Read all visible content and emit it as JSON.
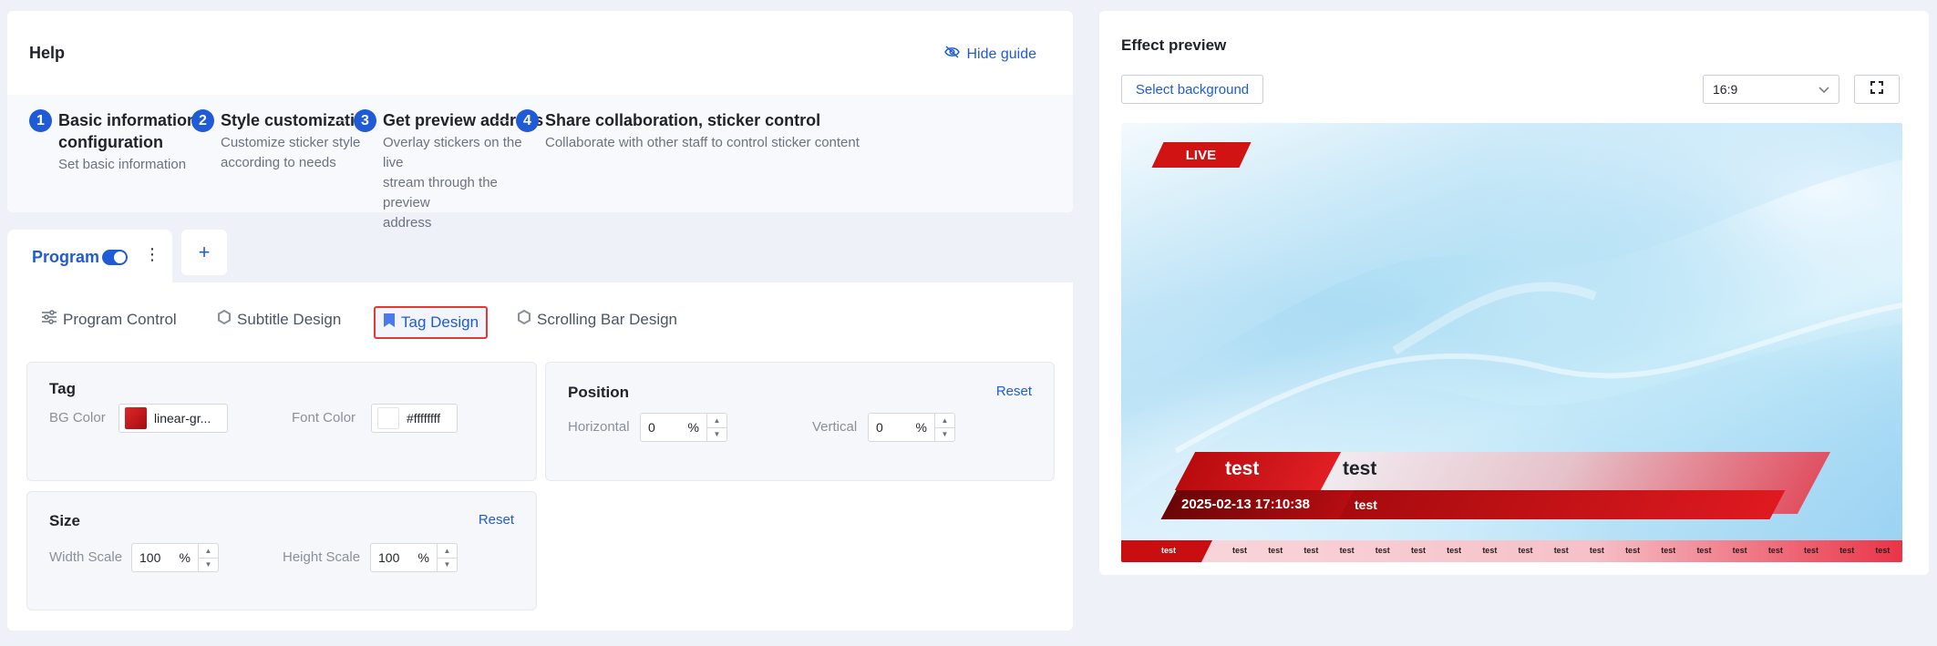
{
  "help": {
    "title": "Help",
    "hide_guide": "Hide guide",
    "steps": [
      {
        "num": "1",
        "title_line1": "Basic information",
        "title_line2": "configuration",
        "desc_lines": [
          "Set basic information"
        ]
      },
      {
        "num": "2",
        "title_line1": "Style customization",
        "desc_lines": [
          "Customize sticker style",
          "according to needs"
        ]
      },
      {
        "num": "3",
        "title_line1": "Get preview address",
        "desc_lines": [
          "Overlay stickers on the live",
          "stream through the preview",
          "address"
        ]
      },
      {
        "num": "4",
        "title_line1": "Share collaboration, sticker control",
        "desc_lines": [
          "Collaborate with other staff to control sticker content"
        ]
      }
    ]
  },
  "program_tab": {
    "label": "Program",
    "add_label": "+",
    "enabled": true
  },
  "sub_tabs": [
    {
      "label": "Program Control",
      "icon": "sliders-icon"
    },
    {
      "label": "Subtitle Design",
      "icon": "hexagon-icon"
    },
    {
      "label": "Tag Design",
      "icon": "bookmark-icon",
      "active": true
    },
    {
      "label": "Scrolling Bar Design",
      "icon": "hexagon-icon"
    }
  ],
  "tag_panel": {
    "title": "Tag",
    "bg_color_label": "BG Color",
    "bg_color_value": "linear-gr...",
    "font_color_label": "Font Color",
    "font_color_value": "#ffffffff"
  },
  "position_panel": {
    "title": "Position",
    "reset": "Reset",
    "horizontal_label": "Horizontal",
    "horizontal_value": "0",
    "vertical_label": "Vertical",
    "vertical_value": "0",
    "unit": "%"
  },
  "size_panel": {
    "title": "Size",
    "reset": "Reset",
    "width_label": "Width Scale",
    "width_value": "100",
    "height_label": "Height Scale",
    "height_value": "100",
    "unit": "%"
  },
  "preview": {
    "title": "Effect preview",
    "select_background": "Select background",
    "ratio": "16:9",
    "live_label": "LIVE",
    "lower_third": {
      "tag_text": "test",
      "title_text": "test",
      "datetime": "2025-02-13 17:10:38",
      "subtitle_text": "test"
    },
    "ticker": {
      "first": "test",
      "items": [
        "test",
        "test",
        "test",
        "test",
        "test",
        "test",
        "test",
        "test",
        "test",
        "test",
        "test",
        "test",
        "test",
        "test",
        "test",
        "test",
        "test",
        "test",
        "test"
      ]
    }
  },
  "colors": {
    "accent": "#1f5bd6",
    "highlight": "#e53935",
    "tag_red": "#d11313"
  }
}
